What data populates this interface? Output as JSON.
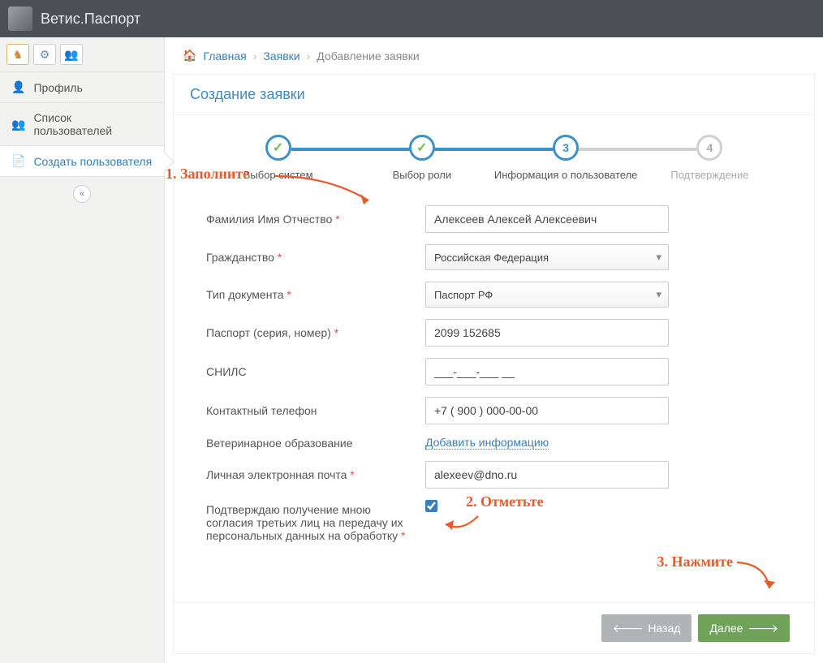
{
  "app_title": "Ветис.Паспорт",
  "breadcrumbs": {
    "home": "Главная",
    "requests": "Заявки",
    "add": "Добавление заявки"
  },
  "sidebar": {
    "profile": "Профиль",
    "users_list": "Список пользователей",
    "create_user": "Создать пользователя"
  },
  "panel_title": "Создание заявки",
  "steps": {
    "s1": "Выбор систем",
    "s2": "Выбор роли",
    "s3": "Информация о пользователе",
    "s4": "Подтверждение"
  },
  "form": {
    "fio_label": "Фамилия Имя Отчество",
    "fio_value": "Алексеев Алексей Алексеевич",
    "citizenship_label": "Гражданство",
    "citizenship_value": "Российская Федерация",
    "doctype_label": "Тип документа",
    "doctype_value": "Паспорт РФ",
    "passport_label": "Паспорт (серия, номер)",
    "passport_value": "2099 152685",
    "snils_label": "СНИЛС",
    "snils_value": "___-___-___ __",
    "phone_label": "Контактный телефон",
    "phone_value": "+7 ( 900 ) 000-00-00",
    "education_label": "Ветеринарное образование",
    "education_link": "Добавить информацию",
    "email_label": "Личная электронная почта",
    "email_value": "alexeev@dno.ru",
    "consent_label": "Подтверждаю получение мною согласия третьих лиц на передачу их персональных данных на обработку",
    "consent_checked": true
  },
  "buttons": {
    "back": "Назад",
    "next": "Далее"
  },
  "annotations": {
    "a1": "1. Заполните",
    "a2": "2. Отметьте",
    "a3": "3. Нажмите"
  }
}
